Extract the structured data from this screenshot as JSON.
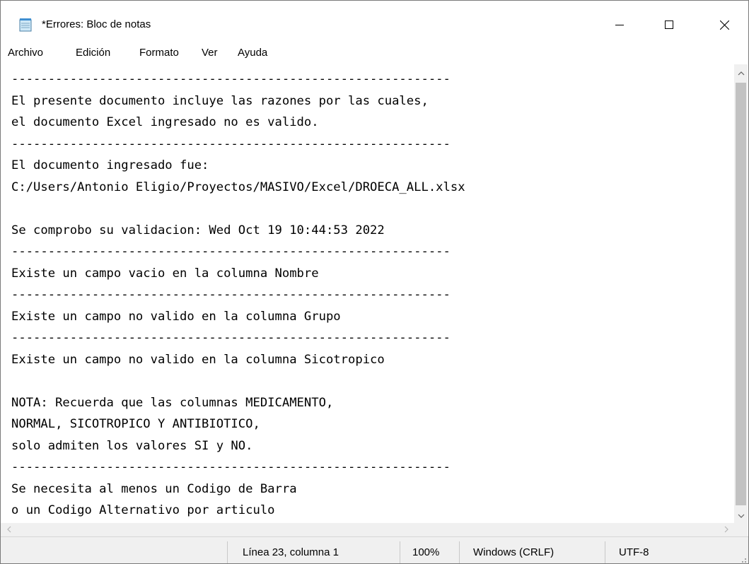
{
  "window": {
    "title": "*Errores: Bloc de notas"
  },
  "menu": [
    "Archivo",
    "Edición",
    "Formato",
    "Ver",
    "Ayuda"
  ],
  "document": {
    "lines": [
      "------------------------------------------------------------",
      "El presente documento incluye las razones por las cuales,",
      "el documento Excel ingresado no es valido.",
      "------------------------------------------------------------",
      "El documento ingresado fue:",
      "C:/Users/Antonio Eligio/Proyectos/MASIVO/Excel/DROECA_ALL.xlsx",
      "",
      "Se comprobo su validacion: Wed Oct 19 10:44:53 2022",
      "------------------------------------------------------------",
      "Existe un campo vacio en la columna Nombre",
      "------------------------------------------------------------",
      "Existe un campo no valido en la columna Grupo",
      "------------------------------------------------------------",
      "Existe un campo no valido en la columna Sicotropico",
      "",
      "NOTA: Recuerda que las columnas MEDICAMENTO,",
      "NORMAL, SICOTROPICO Y ANTIBIOTICO,",
      "solo admiten los valores SI y NO.",
      "------------------------------------------------------------",
      "Se necesita al menos un Codigo de Barra",
      "o un Codigo Alternativo por articulo",
      "------------------------------------------------------------"
    ]
  },
  "status": {
    "position": "Línea 23, columna 1",
    "zoom": "100%",
    "line_ending": "Windows (CRLF)",
    "encoding": "UTF-8"
  },
  "icons": {
    "app": "notepad-icon",
    "minimize": "minimize-icon",
    "maximize": "maximize-icon",
    "close": "close-icon",
    "scroll_up": "chevron-up-icon",
    "scroll_down": "chevron-down-icon",
    "scroll_left": "chevron-left-icon",
    "scroll_right": "chevron-right-icon"
  }
}
